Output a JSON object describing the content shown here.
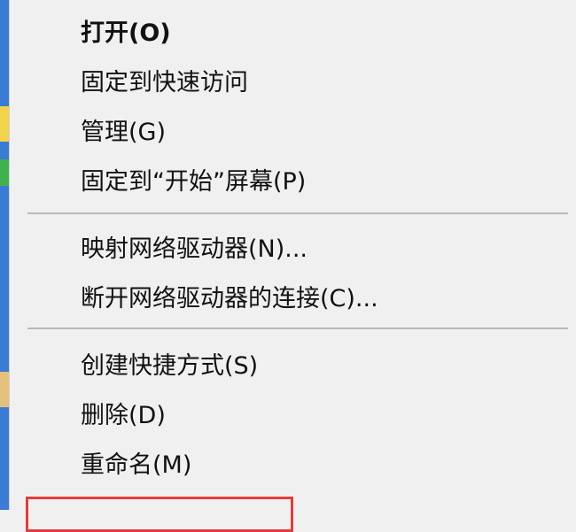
{
  "menu": {
    "groups": [
      {
        "items": [
          {
            "label": "打开(O)",
            "bold": true
          },
          {
            "label": "固定到快速访问"
          },
          {
            "label": "管理(G)"
          },
          {
            "label": "固定到“开始”屏幕(P)"
          }
        ]
      },
      {
        "items": [
          {
            "label": "映射网络驱动器(N)..."
          },
          {
            "label": "断开网络驱动器的连接(C)..."
          }
        ]
      },
      {
        "items": [
          {
            "label": "创建快捷方式(S)"
          },
          {
            "label": "删除(D)"
          },
          {
            "label": "重命名(M)"
          }
        ]
      }
    ]
  },
  "colors": {
    "menu_background": "#f0f0f0",
    "separator": "#b9b9b9",
    "highlight": "#e23b3b",
    "text": "#111111"
  }
}
